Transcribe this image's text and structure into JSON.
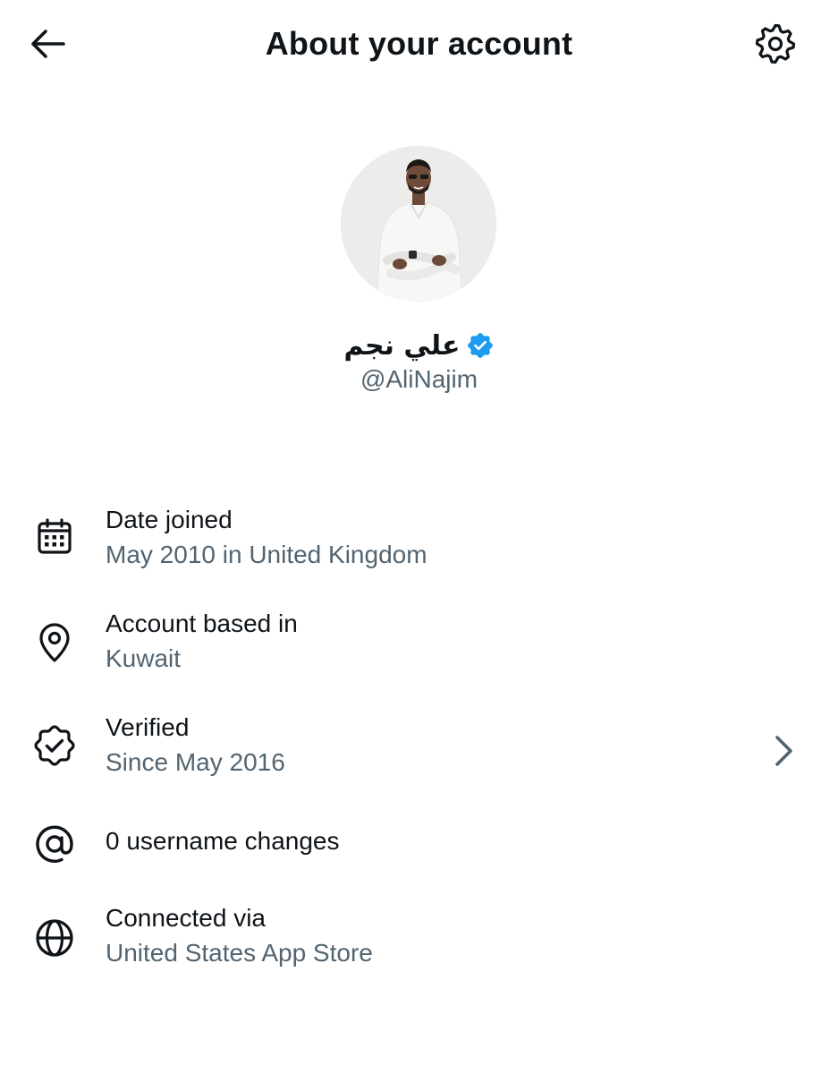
{
  "header": {
    "title": "About your account",
    "back_icon": "arrow-left-icon",
    "settings_icon": "gear-icon"
  },
  "profile": {
    "display_name": "علي نجم",
    "handle": "@AliNajim",
    "verified_badge_color": "#1d9bf0"
  },
  "info": [
    {
      "icon": "calendar-icon",
      "title": "Date joined",
      "subtitle": "May 2010 in United Kingdom"
    },
    {
      "icon": "location-pin-icon",
      "title": "Account based in",
      "subtitle": "Kuwait"
    },
    {
      "icon": "verified-badge-outline-icon",
      "title": "Verified",
      "subtitle": "Since May 2016",
      "has_chevron": true
    },
    {
      "icon": "at-sign-icon",
      "title": "0 username changes",
      "subtitle": ""
    },
    {
      "icon": "globe-icon",
      "title": "Connected via",
      "subtitle": "United States App Store"
    }
  ],
  "colors": {
    "text_primary": "#0f1419",
    "text_secondary": "#536471",
    "accent": "#1d9bf0"
  }
}
